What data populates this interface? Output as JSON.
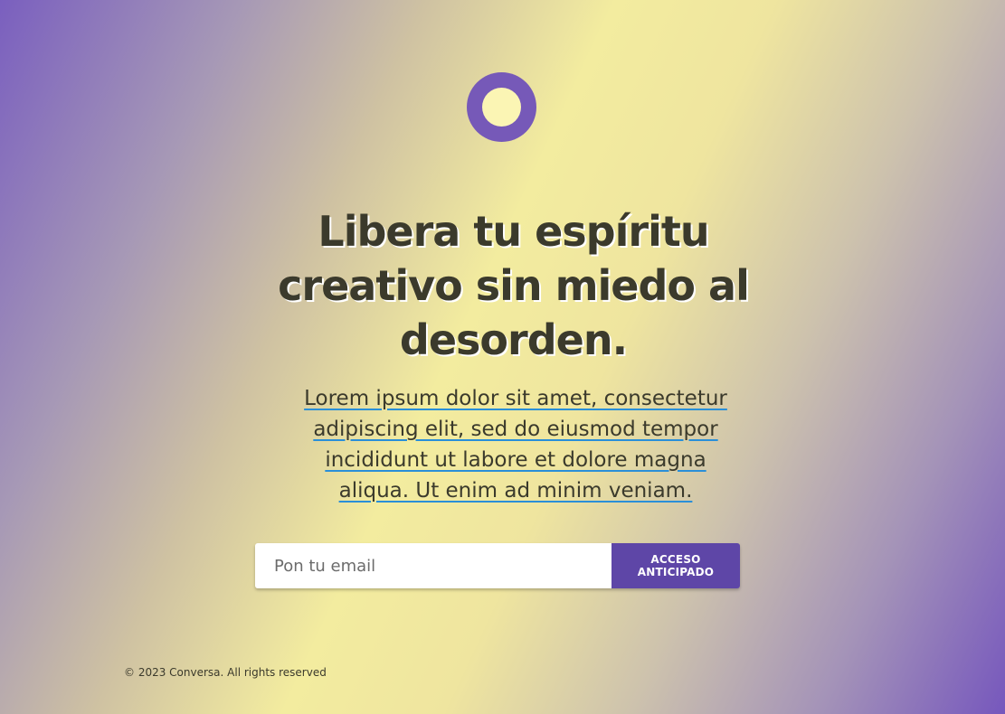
{
  "brand": {
    "logo_icon": "ring-logo-icon",
    "primary_color": "#7659b8",
    "accent_color": "#fbf5b4"
  },
  "hero": {
    "headline": "Libera tu espíritu creativo sin miedo al desorden.",
    "lead_lines": [
      "Lorem ipsum dolor sit amet, consectetur",
      "adipiscing elit, sed do eiusmod tempor",
      "incididunt ut labore et dolore magna",
      "aliqua. Ut enim ad minim veniam."
    ]
  },
  "signup": {
    "email_placeholder": "Pon tu email",
    "email_value": "",
    "button_label": "ACCESO ANTICIPADO",
    "button_color": "#5e46a7"
  },
  "footer": {
    "copyright": "© 2023 Conversa. All rights reserved"
  }
}
